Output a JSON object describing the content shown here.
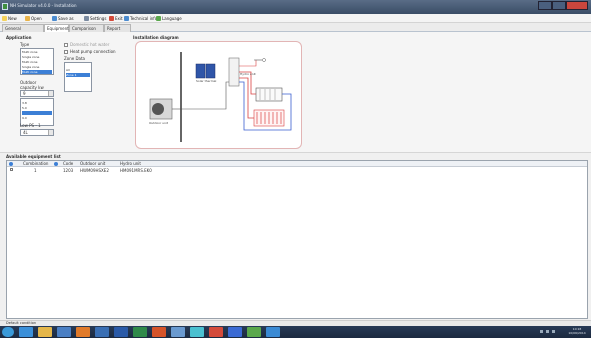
{
  "window": {
    "title": "NH Simulator v4.0.0 - Installation",
    "buttons": [
      "minimize",
      "maximize",
      "close"
    ],
    "titlebar_color": "#3a4d66"
  },
  "menu": [
    {
      "label": "New",
      "icon": "new-icon",
      "color": "#f4d25c"
    },
    {
      "label": "Open",
      "icon": "open-icon",
      "color": "#e8b34a"
    },
    {
      "label": "Save as",
      "icon": "save-icon",
      "color": "#4c8cd0"
    },
    {
      "label": "Settings",
      "icon": "settings-icon",
      "color": "#7a8aa0"
    },
    {
      "label": "Exit",
      "icon": "exit-icon",
      "color": "#d44a3a"
    },
    {
      "label": "Technical info",
      "icon": "info-icon",
      "color": "#4c8cd0"
    },
    {
      "label": "Language",
      "icon": "language-icon",
      "color": "#5aa84c"
    }
  ],
  "tabs": [
    {
      "label": "General conditions",
      "active": false
    },
    {
      "label": "Equipment",
      "active": true
    },
    {
      "label": "Comparison chart",
      "active": false
    },
    {
      "label": "Report print",
      "active": false
    }
  ],
  "application": {
    "heading": "Application",
    "type_label": "Type",
    "type_value": "Multi zone",
    "types": [
      "Multi zone",
      "Single zone",
      "Multi zone",
      "Single zone",
      "Multi zone"
    ],
    "types_selected_index": 4,
    "check1_label": "Domestic hot water",
    "check2_label": "Heat pump connection",
    "zone_label": "Zone Data",
    "zones": [
      "All",
      "Zone 1"
    ],
    "zones_selected_index": 1,
    "outdoor_label": "Outdoor",
    "capacity_label": "capacity kw",
    "capacity_value": "9",
    "capacities": [
      "3.8",
      "5.0",
      "",
      "9.0"
    ],
    "capacities_selected_index": 2,
    "cop_label": "Low PS - 1",
    "cop_value": "4L"
  },
  "diagram": {
    "heading": "Installation diagram",
    "outdoor_unit_label": "Outdoor unit",
    "solar_label": "Solar thermal",
    "hydro_label": "Hydro unit",
    "tank_label": "Tank",
    "accent": "#d94040"
  },
  "equipment": {
    "heading": "Available equipment list",
    "columns": [
      "",
      "Combination",
      "",
      "Code",
      "Outdoor unit",
      "Hydro unit"
    ],
    "rows": [
      [
        "",
        "1",
        "",
        "1203",
        "HWM09HSXE2",
        "HM091MRS.EK0"
      ]
    ]
  },
  "status": {
    "text": "Default condition"
  },
  "taskbar": {
    "apps": [
      {
        "icon": "start-icon",
        "color": "#3a9ad9"
      },
      {
        "icon": "ie-icon",
        "color": "#3a8fd9"
      },
      {
        "icon": "explorer-icon",
        "color": "#e4b64a"
      },
      {
        "icon": "media-icon",
        "color": "#4a7fc4"
      },
      {
        "icon": "firefox-icon",
        "color": "#e07a2a"
      },
      {
        "icon": "outlook-icon",
        "color": "#3a6fb4"
      },
      {
        "icon": "word-icon",
        "color": "#2a5aa8"
      },
      {
        "icon": "excel-icon",
        "color": "#2f8a4a"
      },
      {
        "icon": "ppt-icon",
        "color": "#d6542a"
      },
      {
        "icon": "app-icon",
        "color": "#6a9ad0"
      },
      {
        "icon": "app2-icon",
        "color": "#4ac0d0"
      },
      {
        "icon": "app3-icon",
        "color": "#d44a3a"
      },
      {
        "icon": "app4-icon",
        "color": "#3a6ad4"
      },
      {
        "icon": "app5-icon",
        "color": "#5aa84c"
      },
      {
        "icon": "app6-icon",
        "color": "#3a8ad4"
      }
    ],
    "clock_time": "10:18",
    "clock_date": "10/06/2014"
  }
}
